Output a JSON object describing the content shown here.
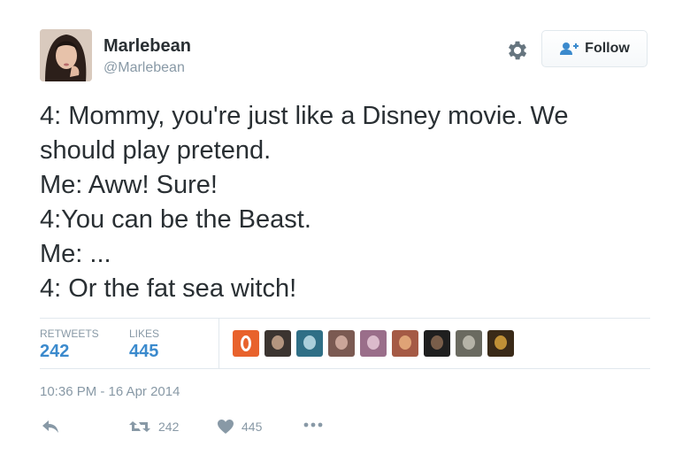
{
  "author": {
    "name": "Marlebean",
    "handle": "@Marlebean"
  },
  "follow_button": {
    "label": "Follow"
  },
  "tweet": {
    "text": "4: Mommy, you're just like a Disney movie. We\nshould play pretend.\nMe: Aww! Sure!\n4:You can be the Beast.\nMe: ...\n4: Or the fat sea witch!"
  },
  "stats": {
    "retweets_label": "RETWEETS",
    "retweets_value": "242",
    "likes_label": "LIKES",
    "likes_value": "445"
  },
  "likers": [
    {
      "color": "#e8622c",
      "accent": "#ffffff"
    },
    {
      "color": "#3b3430",
      "accent": "#c9a78d"
    },
    {
      "color": "#2f6f86",
      "accent": "#bfe1ea"
    },
    {
      "color": "#7b5a52",
      "accent": "#d8b3a6"
    },
    {
      "color": "#9a6e8a",
      "accent": "#e6c9d7"
    },
    {
      "color": "#a55a45",
      "accent": "#e9b07f"
    },
    {
      "color": "#1f1f1f",
      "accent": "#8a6a52"
    },
    {
      "color": "#6a6a60",
      "accent": "#c2c0b4"
    },
    {
      "color": "#3a2a18",
      "accent": "#d8a23c"
    }
  ],
  "timestamp": "10:36 PM - 16 Apr 2014",
  "actions": {
    "reply_icon": "reply-icon",
    "retweet_count": "242",
    "like_count": "445",
    "more_icon": "more-icon"
  },
  "colors": {
    "link_blue": "#3b8acd",
    "muted": "#8899a6",
    "text": "#292f33"
  }
}
